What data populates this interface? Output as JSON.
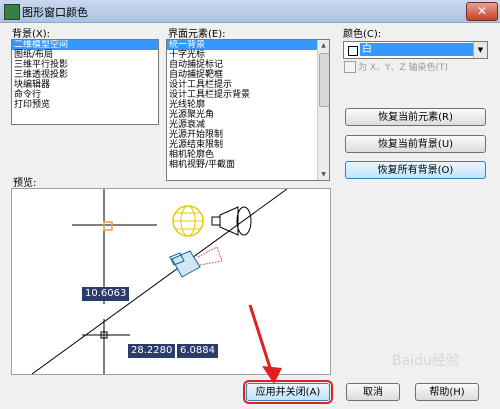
{
  "window": {
    "title": "图形窗口颜色",
    "close_glyph": "✕"
  },
  "background": {
    "label": "背景(X):",
    "items": [
      "二维模型空间",
      "图纸/布局",
      "三维平行投影",
      "三维透视投影",
      "块编辑器",
      "命令行",
      "打印预览"
    ],
    "selected_index": 0
  },
  "elements": {
    "label": "界面元素(E):",
    "items": [
      "统一背景",
      "十字光标",
      "自动捕捉标记",
      "自动捕捉靶框",
      "设计工具栏提示",
      "设计工具栏提示背景",
      "光线轮廓",
      "光源聚光角",
      "光源衰减",
      "光源开始限制",
      "光源结束限制",
      "相机轮廓色",
      "相机视野/平截面"
    ],
    "selected_index": 0
  },
  "color": {
    "label": "颜色(C):",
    "value": "白",
    "tint_checkbox_label": "为 X、Y、Z 轴染色(T)"
  },
  "restore_buttons": {
    "current_element": "恢复当前元素(R)",
    "current_background": "恢复当前背景(U)",
    "all_backgrounds": "恢复所有背景(O)"
  },
  "preview": {
    "label": "预览:",
    "coord_1": "10.6063",
    "coord_2": "28.2280",
    "coord_3": "6.0884"
  },
  "footer": {
    "apply_close": "应用并关闭(A)",
    "cancel": "取消",
    "help": "帮助(H)"
  },
  "watermark": "Baidu经验",
  "colors": {
    "selection": "#3399ff",
    "annotation": "#e02020",
    "coord_tag": "#2b3b6b"
  }
}
